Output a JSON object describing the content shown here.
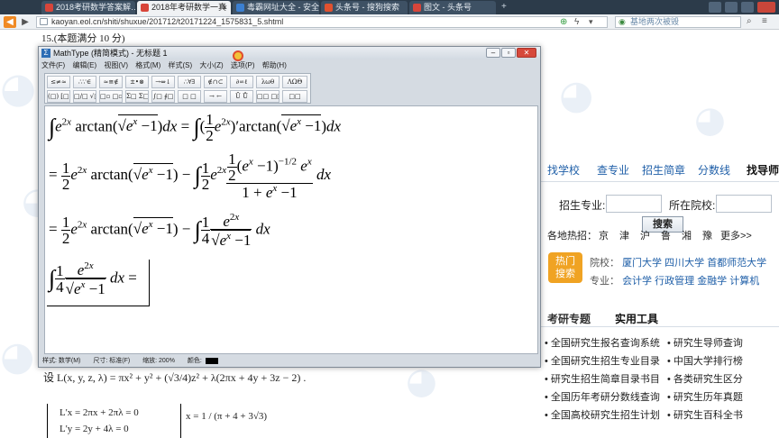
{
  "browser": {
    "tabs": [
      {
        "label": "2018考研数学答案解…",
        "active": false
      },
      {
        "label": "2018年考研数学一真",
        "active": true
      },
      {
        "label": "毒霸网址大全 - 安全…",
        "active": false
      },
      {
        "label": "头条号 - 搜狗搜索",
        "active": false
      },
      {
        "label": "图文 - 头条号",
        "active": false
      }
    ],
    "url": "kaoyan.eol.cn/shiti/shuxue/201712/t20171224_1575831_5.shtml",
    "search_placeholder": "基地两次被毁"
  },
  "page": {
    "problem_heading": "15.(本题满分 10 分)",
    "lagrange_line": "设 L(x, y, z, λ) = πx² + y² + (√3/4)z² + λ(2πx + 4y + 3z − 2) .",
    "system_l1": "L'x = 2πx + 2πλ = 0",
    "system_l2": "L'y = 2y + 4λ = 0",
    "solution_x": "x = 1 / (π + 4 + 3√3)"
  },
  "mathtype": {
    "title": "MathType (精简模式) - 无标题 1",
    "menu": [
      "文件(F)",
      "编辑(E)",
      "视图(V)",
      "格式(M)",
      "样式(S)",
      "大小(Z)",
      "选项(P)",
      "帮助(H)"
    ],
    "toolbar_row1": [
      "≤≠≈",
      "∴∵∈",
      "≈≅∉",
      "±•⊗",
      "→⇔↓",
      "∴∀∃",
      "∉∩⊂",
      "∂∞ℓ",
      "λωθ",
      "ΛΩΘ"
    ],
    "toolbar_row2": [
      "(□) [□]",
      "□/□ √□",
      "□▫ □▫",
      "Σ□ Σ□",
      "∫□ ∮□",
      "□ □",
      "→ ←",
      "Ū Ů",
      "□□ □□",
      "□□"
    ],
    "status": {
      "style": "样式: 数学(M)",
      "size": "尺寸: 标准(F)",
      "zoom": "缩放: 200%",
      "color": "颜色:"
    }
  },
  "sidebar": {
    "tabs": [
      "找学校",
      "查专业",
      "招生简章",
      "分数线",
      "找导师"
    ],
    "major_label": "招生专业:",
    "school_label": "所在院校:",
    "search_button": "搜索",
    "hot_regions_label": "各地热招：",
    "hot_regions": [
      "京",
      "津",
      "沪",
      "鲁",
      "湘",
      "豫"
    ],
    "more": "更多>>",
    "hot_badge_line1": "热门",
    "hot_badge_line2": "搜索",
    "school_prefix": "院校：",
    "hot_schools": [
      "厦门大学",
      "四川大学",
      "首都师范大学"
    ],
    "major_prefix": "专业：",
    "hot_majors": [
      "会计学",
      "行政管理",
      "金融学",
      "计算机"
    ],
    "section_tabs": [
      "考研专题",
      "实用工具"
    ],
    "tools_left": [
      "全国研究生报名查询系统",
      "全国研究生招生专业目录",
      "研究生招生简章目录书目",
      "全国历年考研分数线查询",
      "全国高校研究生招生计划"
    ],
    "tools_right": [
      "研究生导师查询",
      "中国大学排行榜",
      "各类研究生区分",
      "研究生历年真题",
      "研究生百科全书"
    ]
  },
  "colors": {
    "link": "#1f5fa8",
    "hot_badge": "#f0a323",
    "tabbar": "#2c3b4a"
  }
}
